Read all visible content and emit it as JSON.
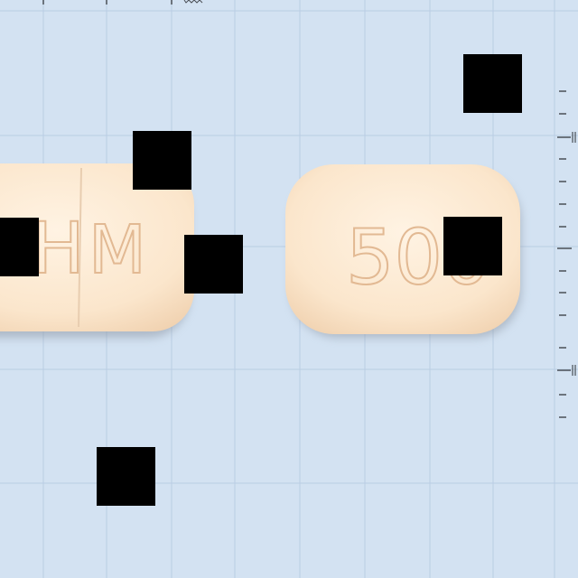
{
  "pill_left": {
    "imprint_left": "H",
    "imprint_right": "M"
  },
  "pill_right": {
    "imprint": "500"
  },
  "colors": {
    "background": "#d3e2f2",
    "grid_line": "#b9cde3",
    "pill_fill": "#fbe6cc",
    "pill_shadow": "#8f98a4",
    "imprint": "#e2b993",
    "occluder": "#000000",
    "ruler": "#4a4f56"
  },
  "occluders": 6
}
